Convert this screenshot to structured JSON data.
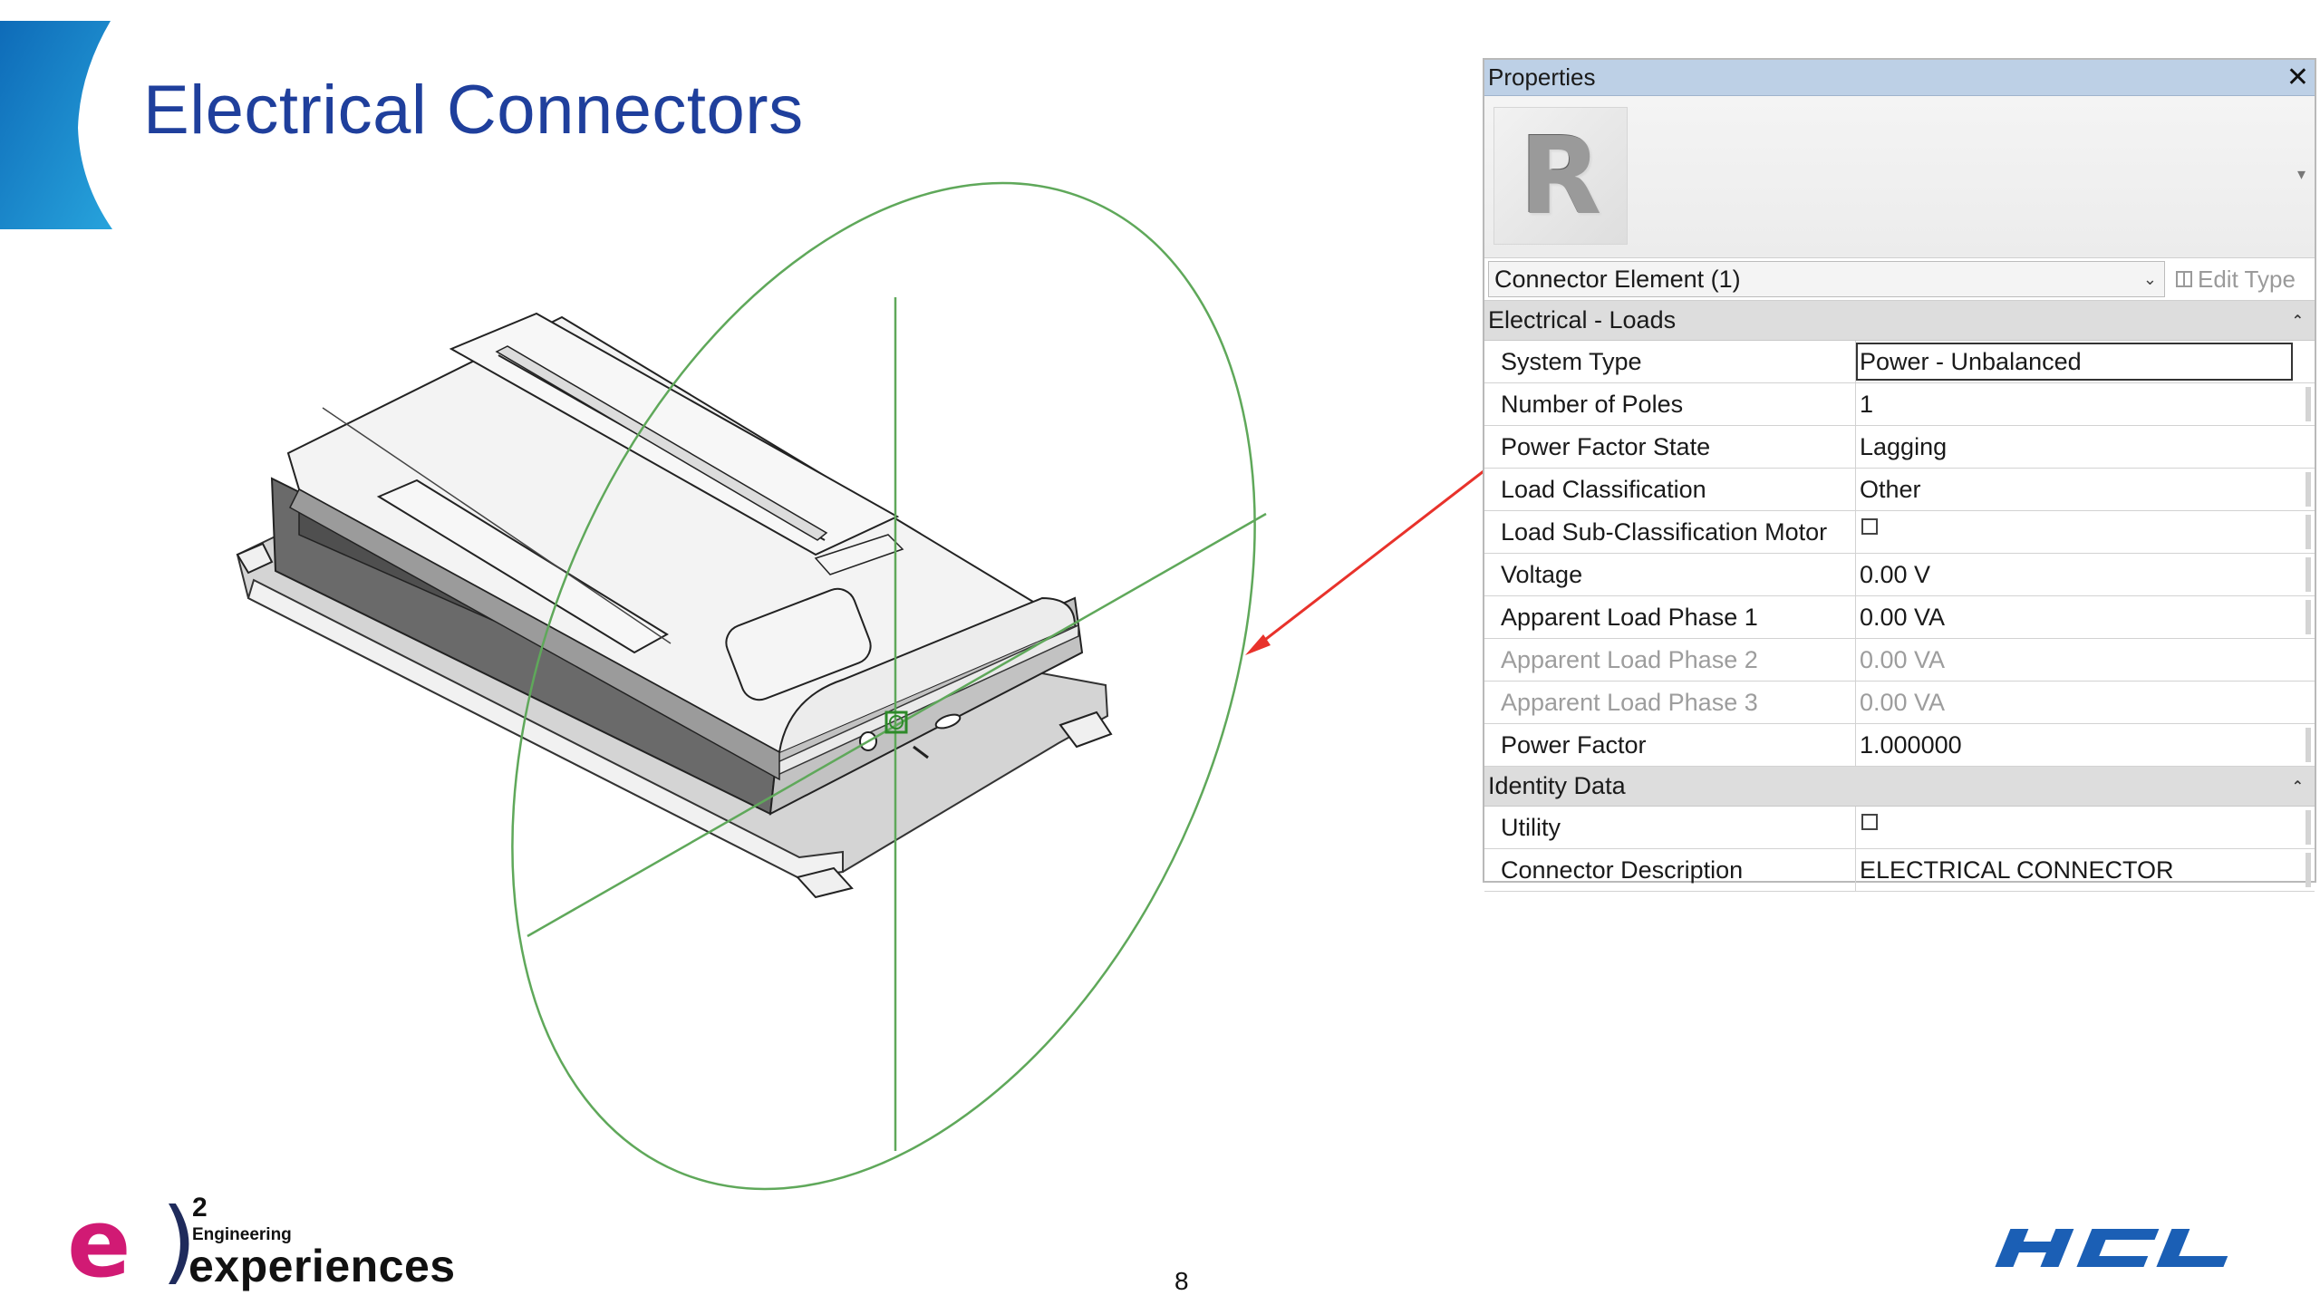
{
  "slide": {
    "title": "Electrical Connectors",
    "page_number": "8",
    "accent_color": "#1679bd",
    "title_color": "#1f3f9c"
  },
  "properties_panel": {
    "title": "Properties",
    "close_icon": "close-icon",
    "type_image": "revit-logo",
    "type_image_letter": "R",
    "type_selector": "Connector Element (1)",
    "edit_type_label": "Edit Type",
    "groups": [
      {
        "name": "Electrical - Loads",
        "rows": [
          {
            "name": "System Type",
            "value": "Power - Unbalanced"
          },
          {
            "name": "Number of Poles",
            "value": "1"
          },
          {
            "name": "Power Factor State",
            "value": "Lagging"
          },
          {
            "name": "Load Classification",
            "value": "Other"
          },
          {
            "name": "Load Sub-Classification Motor",
            "value": "unchecked"
          },
          {
            "name": "Voltage",
            "value": "0.00 V"
          },
          {
            "name": "Apparent Load Phase 1",
            "value": "0.00 VA"
          },
          {
            "name": "Apparent Load Phase 2",
            "value": "0.00 VA"
          },
          {
            "name": "Apparent Load Phase 3",
            "value": "0.00 VA"
          },
          {
            "name": "Power Factor",
            "value": "1.000000"
          }
        ]
      },
      {
        "name": "Identity Data",
        "rows": [
          {
            "name": "Utility",
            "value": "unchecked"
          },
          {
            "name": "Connector Description",
            "value": "ELECTRICAL CONNECTOR"
          }
        ]
      }
    ]
  },
  "drawing": {
    "connector_circle_color": "#5fa85a",
    "arrow_color": "#e8322b"
  },
  "logos": {
    "e2": {
      "superscript": "2",
      "line1": "Engineering",
      "line2": "experiences",
      "mark": "e",
      "mark_color": "#d11a74"
    },
    "hcl": {
      "text": "HCL",
      "color": "#1b5fb5"
    }
  }
}
